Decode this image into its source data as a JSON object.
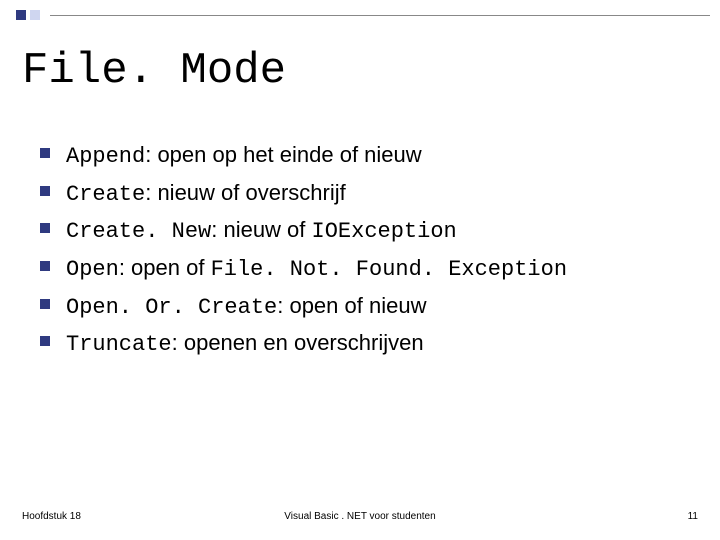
{
  "title": "File. Mode",
  "items": [
    {
      "term": "Append",
      "desc": ": open op het einde of nieuw"
    },
    {
      "term": "Create",
      "desc": ": nieuw of overschrijf"
    },
    {
      "term": "Create. New",
      "desc": ": nieuw of ",
      "tail_mono": "IOException"
    },
    {
      "term": "Open",
      "desc": ": open of ",
      "tail_mono": "File. Not. Found. Exception"
    },
    {
      "term": "Open. Or. Create",
      "desc": ": open of nieuw"
    },
    {
      "term": "Truncate",
      "desc": ": openen en overschrijven"
    }
  ],
  "footer": {
    "left": "Hoofdstuk 18",
    "center": "Visual Basic . NET voor studenten",
    "right": "11"
  }
}
